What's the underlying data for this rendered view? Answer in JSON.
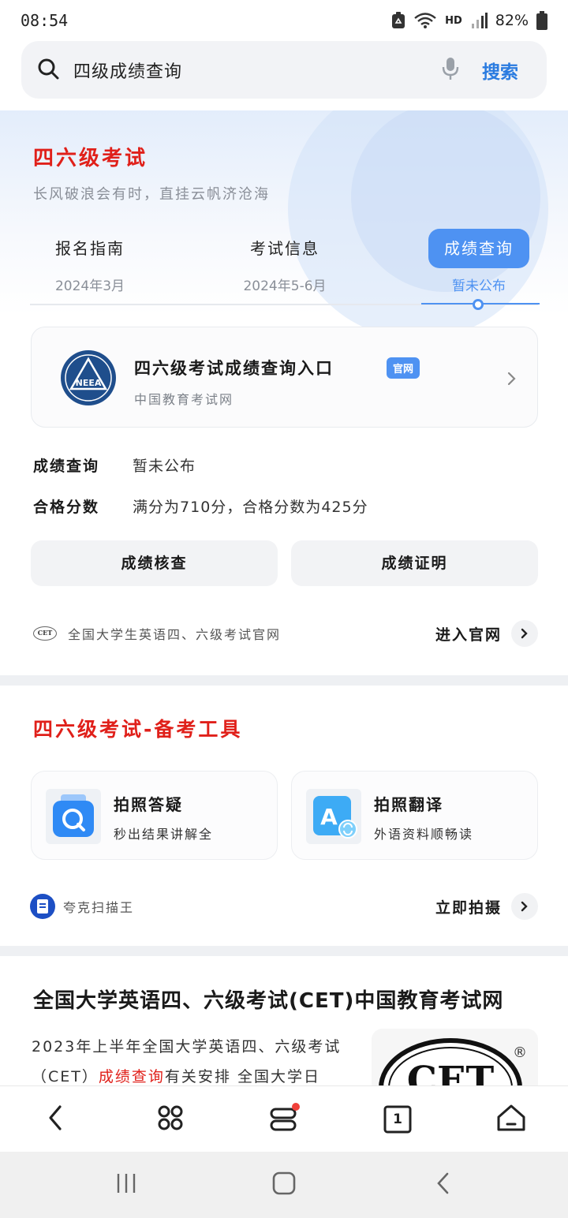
{
  "status_bar": {
    "time": "08:54",
    "network": "HD",
    "battery": "82%"
  },
  "search": {
    "query": "四级成绩查询",
    "button_label": "搜索"
  },
  "exam_card": {
    "title": "四六级考试",
    "subtitle": "长风破浪会有时，直挂云帆济沧海",
    "tabs": [
      {
        "label": "报名指南",
        "date": "2024年3月",
        "active": false
      },
      {
        "label": "考试信息",
        "date": "2024年5-6月",
        "active": false
      },
      {
        "label": "成绩查询",
        "date": "暂未公布",
        "active": true
      }
    ],
    "entry": {
      "title": "四六级考试成绩查询入口",
      "badge": "官网",
      "source": "中国教育考试网",
      "logo_text": "NEEA"
    },
    "info": [
      {
        "key": "成绩查询",
        "value": "暂未公布"
      },
      {
        "key": "合格分数",
        "value": "满分为710分，合格分数为425分"
      }
    ],
    "buttons": [
      "成绩核查",
      "成绩证明"
    ],
    "footer": {
      "logo_text": "CET",
      "text": "全国大学生英语四、六级考试官网",
      "link": "进入官网"
    }
  },
  "tools_card": {
    "title": "四六级考试-备考工具",
    "tools": [
      {
        "name": "拍照答疑",
        "desc": "秒出结果讲解全",
        "icon": "photo-qa-icon"
      },
      {
        "name": "拍照翻译",
        "desc": "外语资料顺畅读",
        "icon": "photo-translate-icon"
      }
    ],
    "footer": {
      "text": "夸克扫描王",
      "link": "立即拍摄"
    }
  },
  "result_card": {
    "title": "全国大学英语四、六级考试(CET)中国教育考试网",
    "snippet_before": "2023年上半年全国大学英语四、六级考试（CET）",
    "snippet_highlight": "成绩查询",
    "snippet_after": "有关安排 全国大学日",
    "thumb_text": "CET",
    "thumb_mark": "®"
  },
  "bottom_nav": {
    "tab_count": "1"
  },
  "colors": {
    "accent": "#4e92f2",
    "title_red": "#e0201a",
    "search_blue": "#2a7be0"
  }
}
